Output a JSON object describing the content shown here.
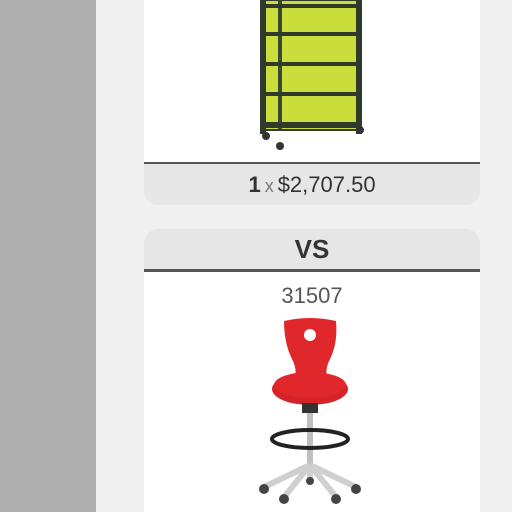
{
  "top_card": {
    "product_image": "bookshelf-image",
    "quantity": "1",
    "times_symbol": "x",
    "price": "$2,707.50"
  },
  "compare_divider": {
    "label": "VS"
  },
  "bottom_card": {
    "product_code": "31507",
    "product_image": "red-stool-chair-image"
  },
  "colors": {
    "left_panel": "#b0b0b0",
    "background": "#f0f0f0",
    "bar": "#e6e6e6",
    "shelf_accent": "#c9dd3b",
    "chair_red": "#e0272b"
  }
}
